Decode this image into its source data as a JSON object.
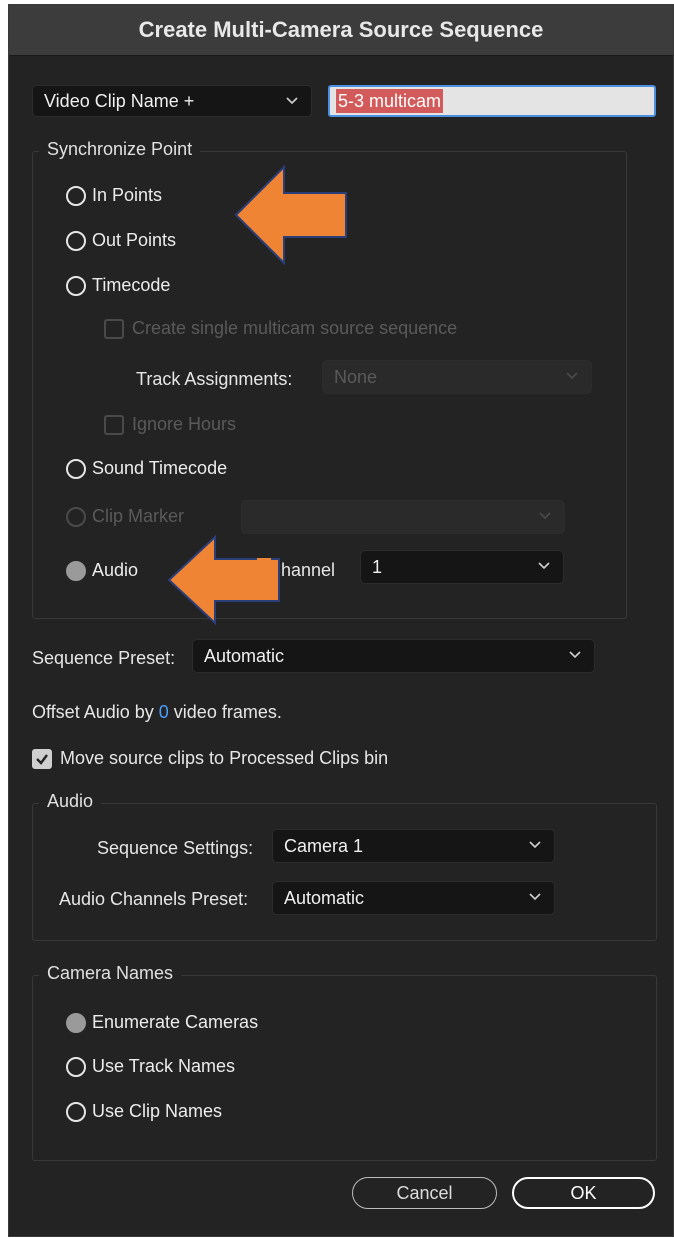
{
  "dialog": {
    "title": "Create Multi-Camera Source Sequence"
  },
  "naming": {
    "dropdown_value": "Video Clip Name +",
    "name_field_value": "5-3 multicam"
  },
  "sync": {
    "legend": "Synchronize Point",
    "in_points": "In Points",
    "out_points": "Out Points",
    "timecode": "Timecode",
    "create_single": "Create single multicam source sequence",
    "track_assignments_label": "Track Assignments:",
    "track_assignments_value": "None",
    "ignore_hours": "Ignore Hours",
    "sound_timecode": "Sound Timecode",
    "clip_marker": "Clip Marker",
    "audio": "Audio",
    "channel_label": "Channel",
    "channel_value": "1"
  },
  "preset": {
    "label": "Sequence Preset:",
    "value": "Automatic"
  },
  "offset": {
    "prefix": "Offset Audio by",
    "value": "0",
    "suffix": "video frames."
  },
  "move_clips": {
    "label": "Move source clips to Processed Clips bin",
    "checked": true
  },
  "audio_group": {
    "legend": "Audio",
    "seq_settings_label": "Sequence Settings:",
    "seq_settings_value": "Camera 1",
    "channels_preset_label": "Audio Channels Preset:",
    "channels_preset_value": "Automatic"
  },
  "camera_names": {
    "legend": "Camera Names",
    "enumerate": "Enumerate Cameras",
    "track_names": "Use Track Names",
    "clip_names": "Use Clip Names"
  },
  "buttons": {
    "cancel": "Cancel",
    "ok": "OK"
  },
  "colors": {
    "accent": "#4a9eff",
    "annotation_arrow": "#ee8434",
    "selection": "#d35a5a"
  }
}
